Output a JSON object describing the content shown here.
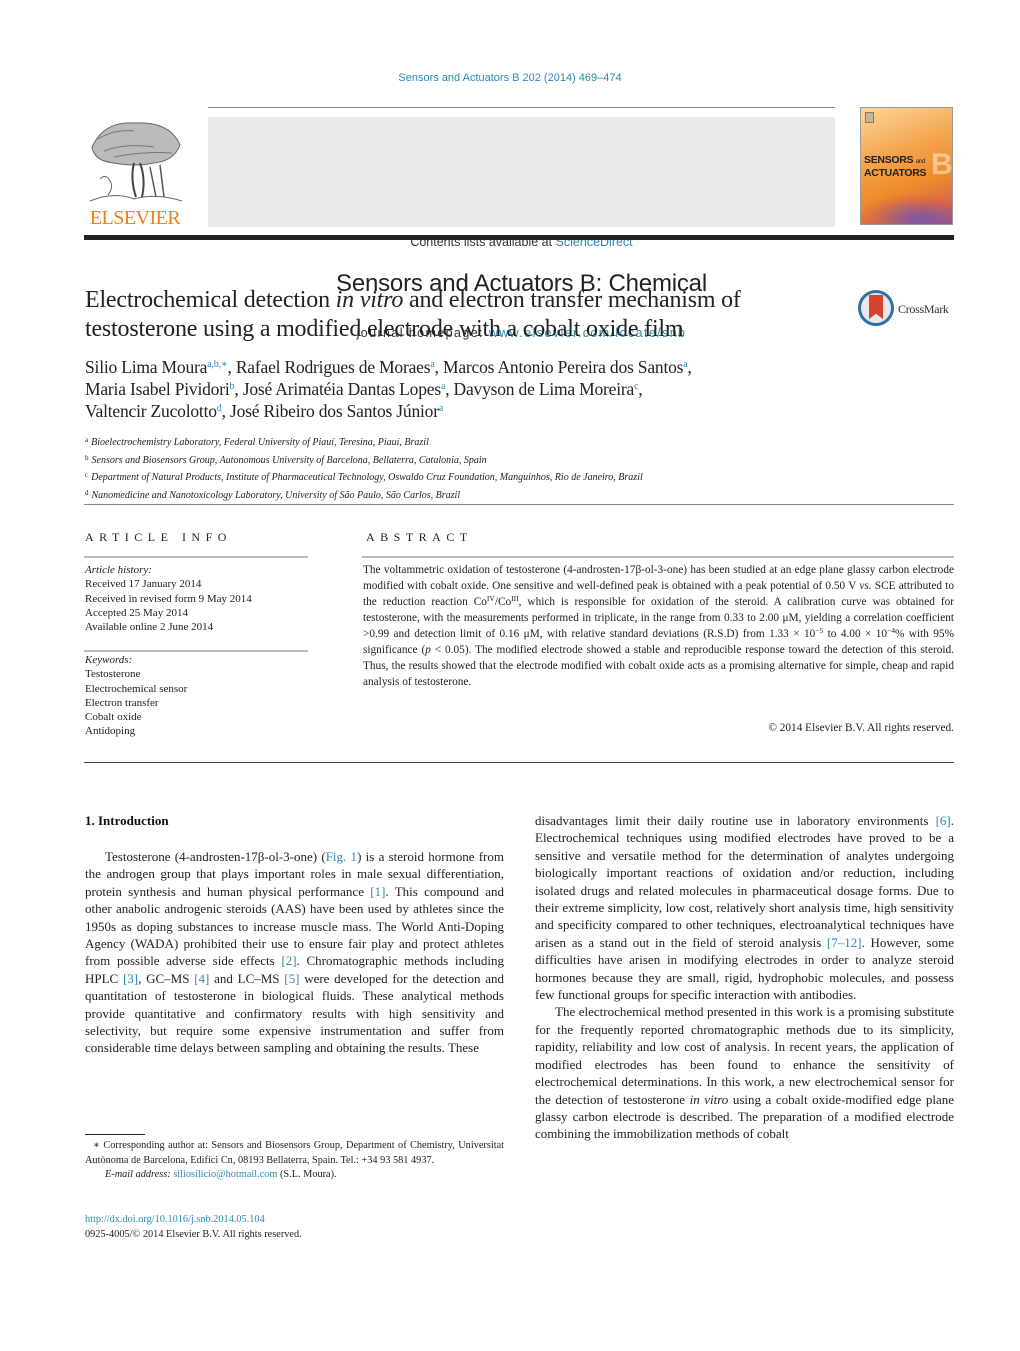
{
  "header": {
    "journal_ref": "Sensors and Actuators B 202 (2014) 469–474",
    "contents_prefix": "Contents lists available at ",
    "contents_link": "ScienceDirect",
    "journal_title": "Sensors and Actuators B: Chemical",
    "homepage_prefix": "journal homepage: ",
    "homepage_link": "www.elsevier.com/locate/snb",
    "publisher_logo_text": "ELSEVIER",
    "cover": {
      "line1": "SENSORS",
      "and": "and",
      "line2": "ACTUATORS",
      "letter": "B"
    },
    "colors": {
      "link": "#2a8ab5",
      "elsevier_orange": "#f07d1a"
    }
  },
  "article": {
    "title_part1": "Electrochemical detection ",
    "title_italic": "in vitro",
    "title_part2": " and electron transfer mechanism of testosterone using a modified electrode with a cobalt oxide film",
    "crossmark_label": "CrossMark",
    "authors": [
      {
        "name": "Silio Lima Moura",
        "sup": "a,b,∗",
        "sep": ", "
      },
      {
        "name": "Rafael Rodrigues de Moraes",
        "sup": "a",
        "sep": ", "
      },
      {
        "name": "Marcos Antonio Pereira dos Santos",
        "sup": "a",
        "sep": ","
      },
      {
        "name": "Maria Isabel Pividori",
        "sup": "b",
        "sep": ", "
      },
      {
        "name": "José Arimatéia Dantas Lopes",
        "sup": "a",
        "sep": ", "
      },
      {
        "name": "Davyson de Lima Moreira",
        "sup": "c",
        "sep": ","
      },
      {
        "name": "Valtencir Zucolotto",
        "sup": "d",
        "sep": ", "
      },
      {
        "name": "José Ribeiro dos Santos Júnior",
        "sup": "a",
        "sep": ""
      }
    ],
    "affiliations": [
      {
        "key": "a",
        "text": "Bioelectrochemistry Laboratory, Federal University of Piauí, Teresina, Piauí, Brazil"
      },
      {
        "key": "b",
        "text": "Sensors and Biosensors Group, Autonomous University of Barcelona, Bellaterra, Catalonia, Spain"
      },
      {
        "key": "c",
        "text": "Department of Natural Products, Institute of Pharmaceutical Technology, Oswaldo Cruz Foundation, Manguinhos, Rio de Janeiro, Brazil"
      },
      {
        "key": "d",
        "text": "Nanomedicine and Nanotoxicology Laboratory, University of São Paulo, São Carlos, Brazil"
      }
    ]
  },
  "article_info": {
    "heading": "ARTICLE INFO",
    "history_label": "Article history:",
    "history": [
      "Received 17 January 2014",
      "Received in revised form 9 May 2014",
      "Accepted 25 May 2014",
      "Available online 2 June 2014"
    ],
    "keywords_label": "Keywords:",
    "keywords": [
      "Testosterone",
      "Electrochemical sensor",
      "Electron transfer",
      "Cobalt oxide",
      "Antidoping"
    ]
  },
  "abstract": {
    "heading": "ABSTRACT",
    "p1": "The voltammetric oxidation of testosterone (4-androsten-17β-ol-3-one) has been studied at an edge plane glassy carbon electrode modified with cobalt oxide. One sensitive and well-defined peak is obtained with a peak potential of 0.50 V ",
    "vs": "vs.",
    "p2": " SCE attributed to the reduction reaction Co",
    "sup_iv": "IV",
    "p3": "/Co",
    "sup_iii": "III",
    "p4": ", which is responsible for oxidation of the steroid. A calibration curve was obtained for testosterone, with the measurements performed in triplicate, in the range from 0.33 to 2.00 μM, yielding a correlation coefficient >0.99 and detection limit of 0.16 μM, with relative standard deviations (R.S.D) from 1.33 × 10",
    "sup_m5": "−5",
    "p5": " to 4.00 × 10",
    "sup_m4": "−4",
    "p6": "% with 95% significance (",
    "p_italic": "p",
    "p7": " < 0.05). The modified electrode showed a stable and reproducible response toward the detection of this steroid. Thus, the results showed that the electrode modified with cobalt oxide acts as a promising alternative for simple, cheap and rapid analysis of testosterone.",
    "copyright": "© 2014 Elsevier B.V. All rights reserved."
  },
  "introduction": {
    "heading": "1.  Introduction",
    "left": {
      "t1": "Testosterone (4-androsten-17β-ol-3-one) (",
      "ref_fig1": "Fig. 1",
      "t2": ") is a steroid hormone from the androgen group that plays important roles in male sexual differentiation, protein synthesis and human physical performance ",
      "ref1": "[1]",
      "t3": ". This compound and other anabolic androgenic steroids (AAS) have been used by athletes since the 1950s as doping substances to increase muscle mass. The World Anti-Doping Agency (WADA) prohibited their use to ensure fair play and protect athletes from possible adverse side effects ",
      "ref2": "[2]",
      "t4": ". Chromatographic methods including HPLC ",
      "ref3": "[3]",
      "t5": ", GC–MS ",
      "ref4": "[4]",
      "t6": " and LC–MS ",
      "ref5": "[5]",
      "t7": " were developed for the detection and quantitation of testosterone in biological fluids. These analytical methods provide quantitative and confirmatory results with high sensitivity and selectivity, but require some expensive instrumentation and suffer from considerable time delays between sampling and obtaining the results. These"
    },
    "right": {
      "t1": "disadvantages limit their daily routine use in laboratory environments ",
      "ref6": "[6]",
      "t2": ". Electrochemical techniques using modified electrodes have proved to be a sensitive and versatile method for the determination of analytes undergoing biologically important reactions of oxidation and/or reduction, including isolated drugs and related molecules in pharmaceutical dosage forms. Due to their extreme simplicity, low cost, relatively short analysis time, high sensitivity and specificity compared to other techniques, electroanalytical techniques have arisen as a stand out in the field of steroid analysis ",
      "ref7_12": "[7–12]",
      "t3": ". However, some difficulties have arisen in modifying electrodes in order to analyze steroid hormones because they are small, rigid, hydrophobic molecules, and possess few functional groups for specific interaction with antibodies.",
      "p2_t1": "The electrochemical method presented in this work is a promising substitute for the frequently reported chromatographic methods due to its simplicity, rapidity, reliability and low cost of analysis. In recent years, the application of modified electrodes has been found to enhance the sensitivity of electrochemical determinations. In this work, a new electrochemical sensor for the detection of testosterone ",
      "p2_italic": "in vitro",
      "p2_t2": " using a cobalt oxide-modified edge plane glassy carbon electrode is described. The preparation of a modified electrode combining the immobilization methods of cobalt"
    }
  },
  "footnote": {
    "star": "∗",
    "text": " Corresponding author at: Sensors and Biosensors Group, Department of Chemistry, Universitat Autònoma de Barcelona, Edifici Cn, 08193 Bellaterra, Spain. Tel.: +34 93 581 4937.",
    "email_label": "E-mail address: ",
    "email": "siliosilicio@hotmail.com",
    "email_suffix": " (S.L. Moura)."
  },
  "doi": {
    "link": "http://dx.doi.org/10.1016/j.snb.2014.05.104",
    "issn_line": "0925-4005/© 2014 Elsevier B.V. All rights reserved."
  }
}
